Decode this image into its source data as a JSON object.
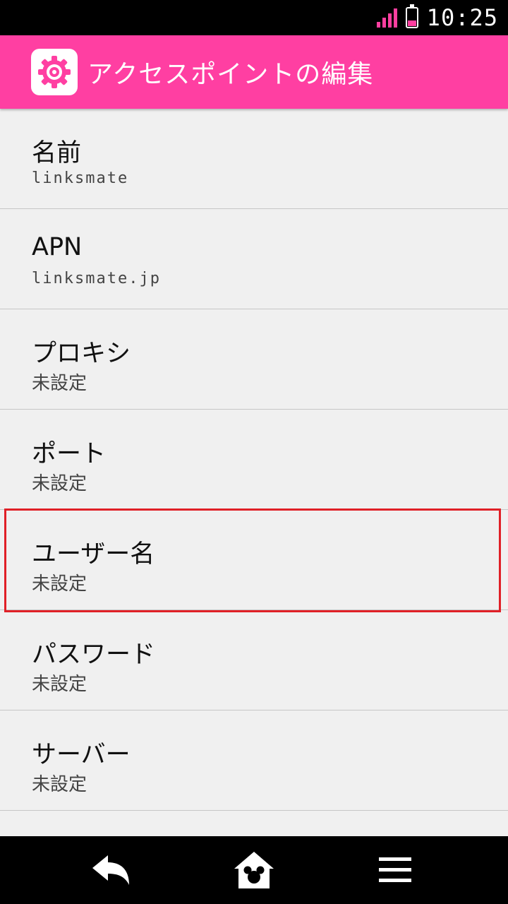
{
  "status": {
    "time": "10:25",
    "signal_color": "#ff3fa0",
    "battery_color": "#ff3fa0"
  },
  "appbar": {
    "title": "アクセスポイントの編集",
    "color": "#ff3fa2",
    "icon": "settings-gear-icon"
  },
  "list": {
    "items": [
      {
        "title": "名前",
        "value": "linksmate"
      },
      {
        "title": "APN",
        "value": "linksmate.jp"
      },
      {
        "title": "プロキシ",
        "value": "未設定"
      },
      {
        "title": "ポート",
        "value": "未設定"
      },
      {
        "title": "ユーザー名",
        "value": "未設定",
        "highlighted": true
      },
      {
        "title": "パスワード",
        "value": "未設定"
      },
      {
        "title": "サーバー",
        "value": "未設定"
      }
    ]
  },
  "navbar": {
    "back_icon": "back-arrow-icon",
    "home_icon": "home-icon",
    "menu_icon": "menu-icon"
  },
  "highlight_color": "#e02027"
}
